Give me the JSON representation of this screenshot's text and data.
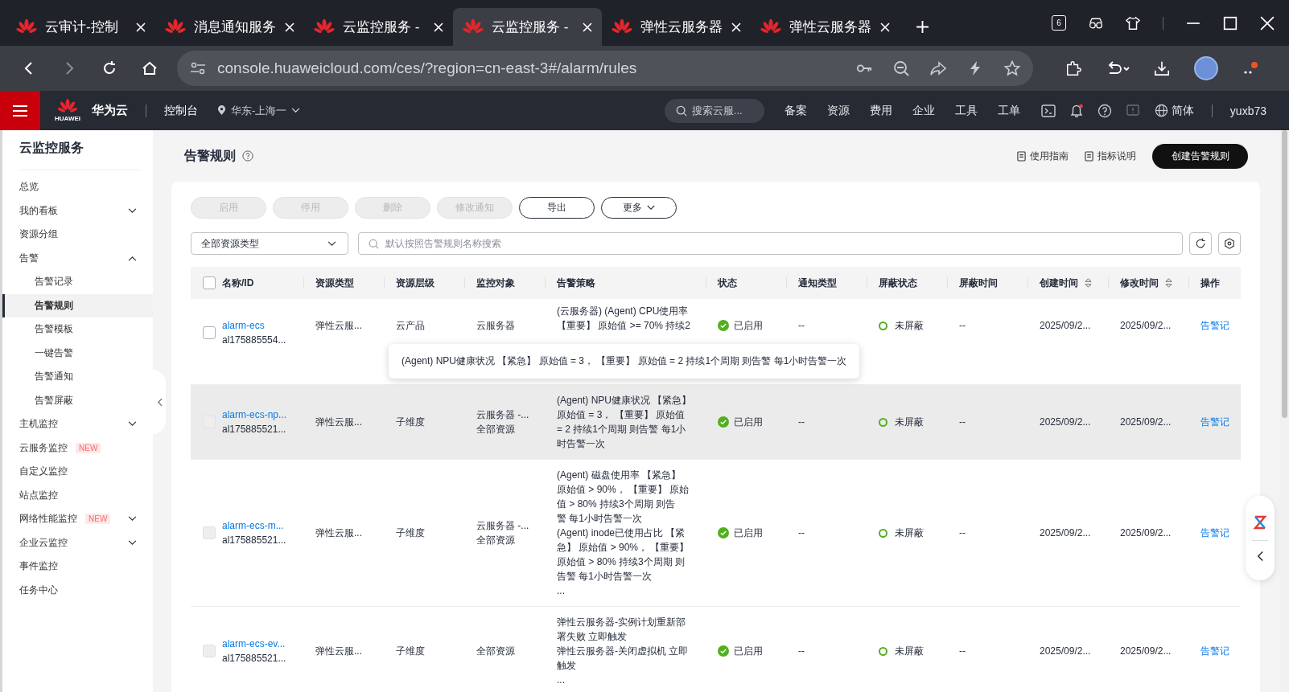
{
  "browser": {
    "tabs": [
      {
        "title": "云审计-控制",
        "selected": false
      },
      {
        "title": "消息通知服务",
        "selected": false
      },
      {
        "title": "云监控服务 -",
        "selected": false
      },
      {
        "title": "云监控服务 -",
        "selected": true
      },
      {
        "title": "弹性云服务器",
        "selected": false
      },
      {
        "title": "弹性云服务器",
        "selected": false
      }
    ],
    "tab_count": "6",
    "url": "console.huaweicloud.com/ces/?region=cn-east-3#/alarm/rules"
  },
  "header": {
    "logo_text": "HUAWEI",
    "brand": "华为云",
    "console": "控制台",
    "region": "华东-上海一",
    "search_placeholder": "搜索云服...",
    "links": [
      "备案",
      "资源",
      "费用",
      "企业",
      "工具",
      "工单"
    ],
    "language": "简体",
    "user": "yuxb73"
  },
  "sidebar": {
    "title": "云监控服务",
    "items": [
      {
        "label": "总览",
        "selected": false
      },
      {
        "label": "我的看板",
        "selected": false,
        "expanded": false
      },
      {
        "label": "资源分组",
        "selected": false
      },
      {
        "label": "告警",
        "selected": false,
        "expanded": true,
        "children": [
          {
            "label": "告警记录",
            "selected": false
          },
          {
            "label": "告警规则",
            "selected": true
          },
          {
            "label": "告警模板",
            "selected": false
          },
          {
            "label": "一键告警",
            "selected": false
          },
          {
            "label": "告警通知",
            "selected": false
          },
          {
            "label": "告警屏蔽",
            "selected": false
          }
        ]
      },
      {
        "label": "主机监控",
        "selected": false,
        "expanded": false
      },
      {
        "label": "云服务监控",
        "selected": false,
        "badge": "NEW"
      },
      {
        "label": "自定义监控",
        "selected": false
      },
      {
        "label": "站点监控",
        "selected": false
      },
      {
        "label": "网络性能监控",
        "selected": false,
        "badge": "NEW",
        "expanded": false
      },
      {
        "label": "企业云监控",
        "selected": false,
        "expanded": false
      },
      {
        "label": "事件监控",
        "selected": false
      },
      {
        "label": "任务中心",
        "selected": false
      }
    ]
  },
  "page": {
    "title": "告警规则",
    "links": [
      "使用指南",
      "指标说明"
    ],
    "create_button": "创建告警规则"
  },
  "toolbar": {
    "buttons": [
      {
        "label": "启用",
        "disabled": true,
        "kind": "plain"
      },
      {
        "label": "停用",
        "disabled": true,
        "kind": "plain"
      },
      {
        "label": "删除",
        "disabled": true,
        "kind": "plain"
      },
      {
        "label": "修改通知",
        "disabled": true,
        "kind": "plain"
      },
      {
        "label": "导出",
        "disabled": false,
        "kind": "plain"
      },
      {
        "label": "更多",
        "disabled": false,
        "kind": "dropdown"
      }
    ]
  },
  "filter": {
    "resource_type": "全部资源类型",
    "search_placeholder": "默认按照告警规则名称搜索"
  },
  "table": {
    "all_checked": false,
    "columns": [
      {
        "label": "名称/ID",
        "sortable": false
      },
      {
        "label": "资源类型",
        "sortable": false
      },
      {
        "label": "资源层级",
        "sortable": false
      },
      {
        "label": "监控对象",
        "sortable": false
      },
      {
        "label": "告警策略",
        "sortable": false
      },
      {
        "label": "状态",
        "sortable": false
      },
      {
        "label": "通知类型",
        "sortable": false
      },
      {
        "label": "屏蔽状态",
        "sortable": false
      },
      {
        "label": "屏蔽时间",
        "sortable": false
      },
      {
        "label": "创建时间",
        "sortable": true
      },
      {
        "label": "修改时间",
        "sortable": true
      },
      {
        "label": "操作",
        "sortable": false
      }
    ],
    "rows": [
      {
        "checked": false,
        "disabled": false,
        "highlighted": false,
        "name": "alarm-ecs",
        "id": "al175885554...",
        "resource_type": "弹性云服...",
        "level": "云产品",
        "object": [
          "云服务器"
        ],
        "policy": [
          "(云服务器) (Agent) CPU使用率",
          "【重要】 原始值 >= 70% 持续2"
        ],
        "status": "已启用",
        "enabled": true,
        "notify": "--",
        "mask_status": "未屏蔽",
        "masked": false,
        "mask_time": "--",
        "created": "2025/09/2...",
        "modified": "2025/09/2...",
        "action": "告警记"
      },
      {
        "checked": false,
        "disabled": true,
        "highlighted": true,
        "name": "alarm-ecs-np...",
        "id": "al175885521...",
        "resource_type": "弹性云服...",
        "level": "子维度",
        "object": [
          "云服务器 -...",
          "全部资源"
        ],
        "policy": [
          "(Agent) NPU健康状况 【紧急】",
          "原始值 = 3， 【重要】 原始值",
          "= 2 持续1个周期 则告警 每1小",
          "时告警一次"
        ],
        "status": "已启用",
        "enabled": true,
        "notify": "--",
        "mask_status": "未屏蔽",
        "masked": false,
        "mask_time": "--",
        "created": "2025/09/2...",
        "modified": "2025/09/2...",
        "action": "告警记"
      },
      {
        "checked": false,
        "disabled": true,
        "highlighted": false,
        "name": "alarm-ecs-m...",
        "id": "al175885521...",
        "resource_type": "弹性云服...",
        "level": "子维度",
        "object": [
          "云服务器 -...",
          "全部资源"
        ],
        "policy": [
          "(Agent) 磁盘使用率 【紧急】",
          "原始值 > 90%， 【重要】 原始",
          "值 > 80% 持续3个周期 则告",
          "警 每1小时告警一次",
          "(Agent) inode已使用占比 【紧",
          "急】 原始值 > 90%， 【重要】",
          "原始值 > 80% 持续3个周期 则",
          "告警 每1小时告警一次",
          "..."
        ],
        "status": "已启用",
        "enabled": true,
        "notify": "--",
        "mask_status": "未屏蔽",
        "masked": false,
        "mask_time": "--",
        "created": "2025/09/2...",
        "modified": "2025/09/2...",
        "action": "告警记"
      },
      {
        "checked": false,
        "disabled": true,
        "highlighted": false,
        "name": "alarm-ecs-ev...",
        "id": "al175885521...",
        "resource_type": "弹性云服...",
        "level": "子维度",
        "object": [
          "全部资源"
        ],
        "policy": [
          "弹性云服务器-实例计划重新部",
          "署失败 立即触发",
          "弹性云服务器-关闭虚拟机 立即",
          "触发",
          "..."
        ],
        "status": "已启用",
        "enabled": true,
        "notify": "--",
        "mask_status": "未屏蔽",
        "masked": false,
        "mask_time": "--",
        "created": "2025/09/2...",
        "modified": "2025/09/2...",
        "action": "告警记"
      }
    ]
  },
  "tooltip": {
    "text": "(Agent) NPU健康状况 【紧急】 原始值 = 3， 【重要】 原始值 = 2 持续1个周期 则告警 每1小时告警一次"
  }
}
